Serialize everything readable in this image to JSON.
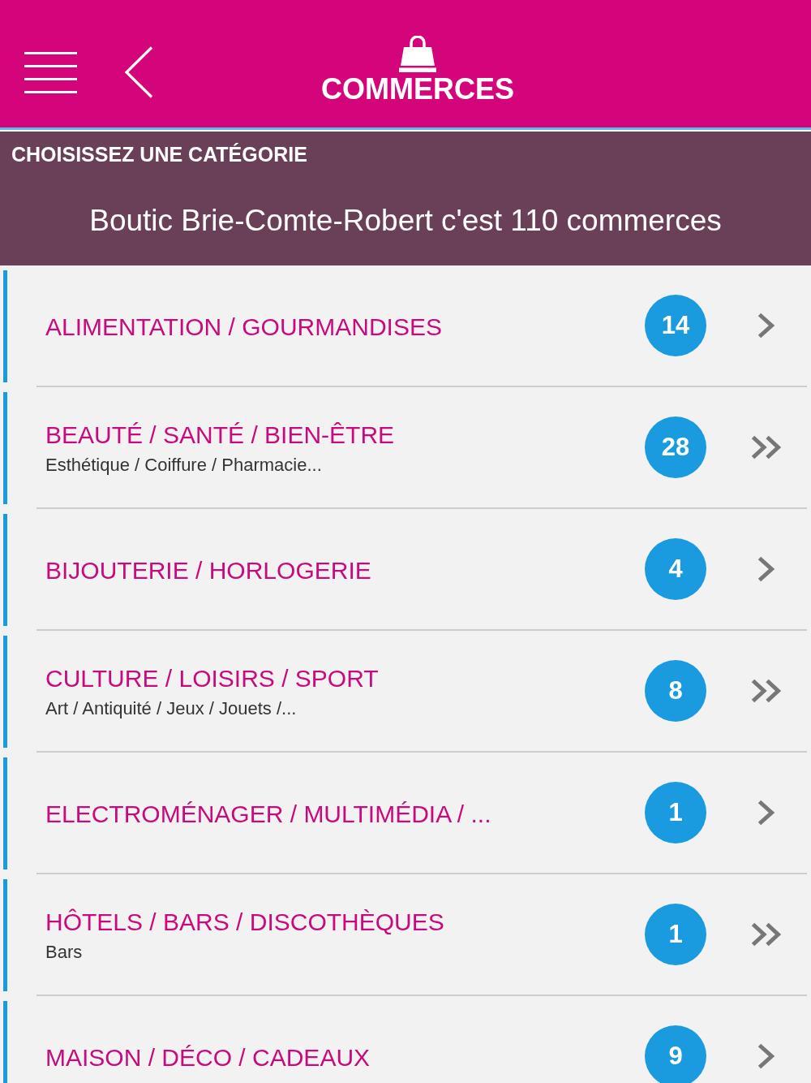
{
  "header": {
    "title": "COMMERCES"
  },
  "banner": {
    "heading": "CHOISISSEZ UNE CATÉGORIE",
    "summary": "Boutic Brie-Comte-Robert c'est 110 commerces"
  },
  "categories": [
    {
      "title": "ALIMENTATION / GOURMANDISES",
      "count": "14",
      "kind": "single"
    },
    {
      "title": "BEAUTÉ / SANTÉ / BIEN-ÊTRE",
      "subtitle": "Esthétique / Coiffure / Pharmacie...",
      "count": "28",
      "kind": "double"
    },
    {
      "title": "BIJOUTERIE / HORLOGERIE",
      "count": "4",
      "kind": "single"
    },
    {
      "title": "CULTURE / LOISIRS / SPORT",
      "subtitle": "Art / Antiquité / Jeux / Jouets /...",
      "count": "8",
      "kind": "double"
    },
    {
      "title": "ELECTROMÉNAGER / MULTIMÉDIA / ...",
      "count": "1",
      "kind": "single"
    },
    {
      "title": "HÔTELS / BARS / DISCOTHÈQUES",
      "subtitle": "Bars",
      "count": "1",
      "kind": "double"
    },
    {
      "title": "MAISON / DÉCO / CADEAUX",
      "count": "9",
      "kind": "single"
    }
  ]
}
